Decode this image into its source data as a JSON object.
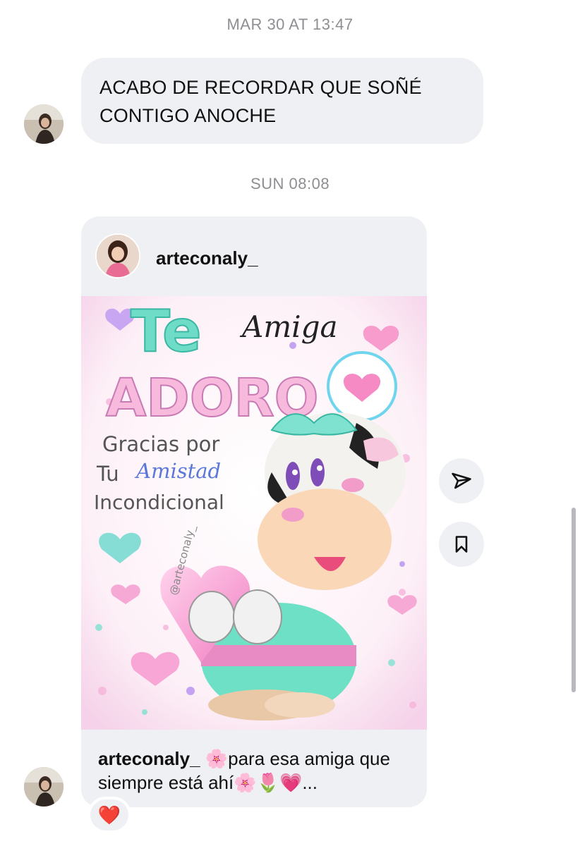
{
  "thread": {
    "timestamp_1": "MAR 30 AT 13:47",
    "message_1": "ACABO DE RECORDAR QUE SOÑÉ CONTIGO ANOCHE",
    "timestamp_2": "SUN 08:08"
  },
  "shared_post": {
    "username": "arteconaly_",
    "image": {
      "headline_1": "Te",
      "headline_2": "Amiga",
      "headline_3": "ADORO",
      "line_1": "Gracias por",
      "line_2_a": "Tu",
      "line_2_b": "Amistad",
      "line_3": "Incondicional",
      "watermark": "@arteconaly_"
    },
    "caption_user": "arteconaly_",
    "caption_text": " 🌸para esa amiga que siempre está ahí🌸🌷💗..."
  },
  "reaction": {
    "emoji": "❤️"
  },
  "icons": {
    "forward": "paper-plane-icon",
    "save": "bookmark-icon"
  },
  "colors": {
    "bubble": "#eff0f4",
    "timestamp": "#8e8e93",
    "teal": "#5fd6c4",
    "pink": "#f3a6d2",
    "purple": "#b07be0"
  }
}
